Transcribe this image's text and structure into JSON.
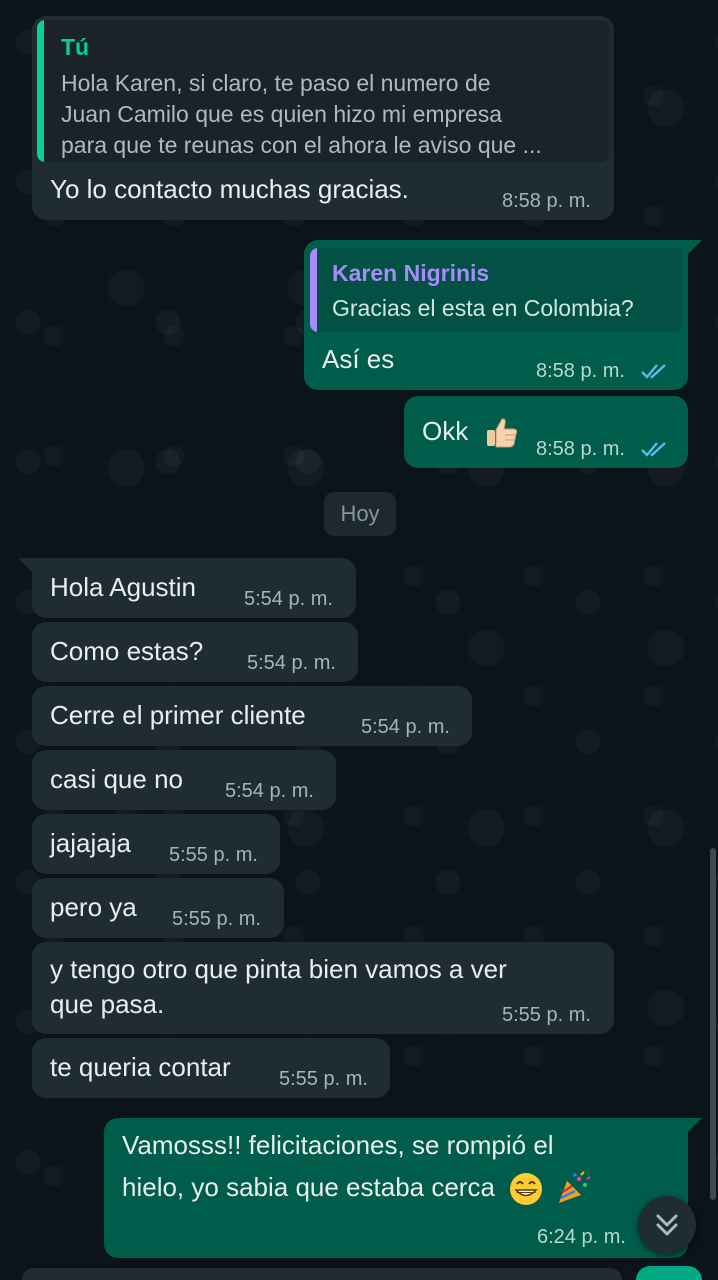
{
  "messages": [
    {
      "quote_name": "Tú",
      "quote_lines": [
        "Hola Karen, si claro, te paso el numero de",
        "Juan Camilo que es quien hizo mi empresa",
        "para que te reunas con el ahora le aviso que ..."
      ],
      "text": "Yo lo contacto muchas gracias.",
      "time": "8:58 p. m."
    },
    {
      "quote_name": "Karen Nigrinis",
      "quote_lines": [
        "Gracias el esta en Colombia?"
      ],
      "text": "Así es",
      "time": "8:58 p. m."
    },
    {
      "text": "Okk",
      "time": "8:58 p. m."
    },
    {
      "text": "Hola Agustin",
      "time": "5:54 p. m."
    },
    {
      "text": "Como estas?",
      "time": "5:54 p. m."
    },
    {
      "text": "Cerre el primer cliente",
      "time": "5:54 p. m."
    },
    {
      "text": "casi que no",
      "time": "5:54 p. m."
    },
    {
      "text": "jajajaja",
      "time": "5:55 p. m."
    },
    {
      "text": "pero ya",
      "time": "5:55 p. m."
    },
    {
      "text_lines": [
        "y tengo otro que pinta bien vamos a ver",
        "que pasa."
      ],
      "time": "5:55 p. m."
    },
    {
      "text": "te queria contar",
      "time": "5:55 p. m."
    },
    {
      "text_lines": [
        "Vamosss!! felicitaciones, se rompió el",
        "hielo, yo sabia que estaba cerca"
      ],
      "time": "6:24 p. m."
    }
  ],
  "day_separator": "Hoy",
  "colors": {
    "incoming": "#202c33",
    "outgoing": "#005c4b",
    "quote_you": "#06cf9c",
    "quote_other": "#a78bfa",
    "read_ticks": "#53bdeb"
  },
  "icons": {
    "thumbs_up": "thumbs-up-emoji",
    "grin": "grinning-emoji",
    "party": "party-popper-emoji",
    "scroll_down": "double-chevron-down-icon",
    "read_receipt": "double-check-icon"
  }
}
